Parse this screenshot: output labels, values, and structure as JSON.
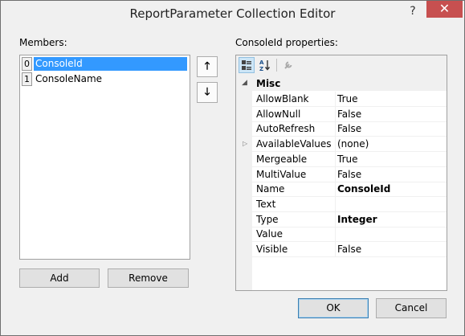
{
  "window": {
    "title": "ReportParameter Collection Editor",
    "help_glyph": "?",
    "close_glyph": "✕"
  },
  "members": {
    "label": "Members:",
    "items": [
      {
        "index": "0",
        "name": "ConsoleId",
        "selected": true
      },
      {
        "index": "1",
        "name": "ConsoleName",
        "selected": false
      }
    ],
    "move_up_glyph": "🡑",
    "move_down_glyph": "🡓",
    "add_label": "Add",
    "remove_label": "Remove"
  },
  "properties": {
    "label": "ConsoleId properties:",
    "toolbar": {
      "categorized_icon": "categorized-icon",
      "alphabetical_icon": "alphabetical-icon",
      "property_pages_icon": "wrench-icon"
    },
    "category": {
      "toggle": "◢",
      "name": "Misc"
    },
    "rows": [
      {
        "name": "AllowBlank",
        "value": "True",
        "bold": false,
        "expandable": false
      },
      {
        "name": "AllowNull",
        "value": "False",
        "bold": false,
        "expandable": false
      },
      {
        "name": "AutoRefresh",
        "value": "False",
        "bold": false,
        "expandable": false
      },
      {
        "name": "AvailableValues",
        "value": "(none)",
        "bold": false,
        "expandable": true
      },
      {
        "name": "Mergeable",
        "value": "True",
        "bold": false,
        "expandable": false
      },
      {
        "name": "MultiValue",
        "value": "False",
        "bold": false,
        "expandable": false
      },
      {
        "name": "Name",
        "value": "ConsoleId",
        "bold": true,
        "expandable": false
      },
      {
        "name": "Text",
        "value": "",
        "bold": false,
        "expandable": false
      },
      {
        "name": "Type",
        "value": "Integer",
        "bold": true,
        "expandable": false
      },
      {
        "name": "Value",
        "value": "",
        "bold": false,
        "expandable": false
      },
      {
        "name": "Visible",
        "value": "False",
        "bold": false,
        "expandable": false
      }
    ]
  },
  "footer": {
    "ok_label": "OK",
    "cancel_label": "Cancel"
  },
  "colors": {
    "selection": "#3399ff",
    "close_button": "#c75050"
  }
}
